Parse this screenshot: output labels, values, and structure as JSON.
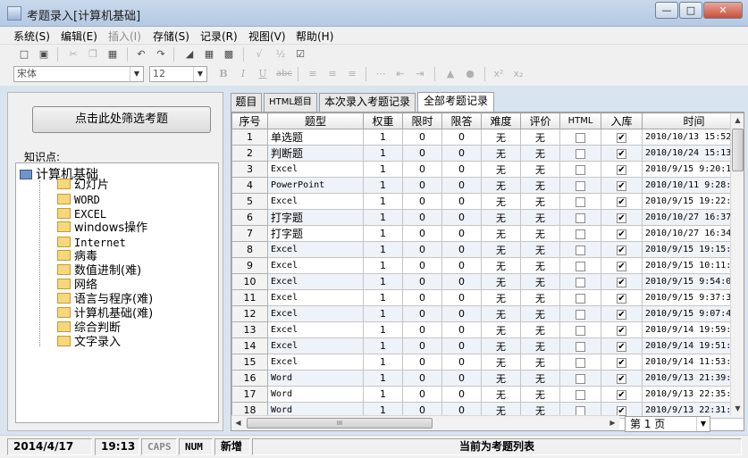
{
  "window": {
    "title": "考题录入[计算机基础]",
    "controls": [
      "minimize",
      "maximize",
      "close"
    ]
  },
  "menu": [
    {
      "label": "系统(S)",
      "enabled": true
    },
    {
      "label": "编辑(E)",
      "enabled": true
    },
    {
      "label": "插入(I)",
      "enabled": false
    },
    {
      "label": "存储(S)",
      "enabled": true
    },
    {
      "label": "记录(R)",
      "enabled": true
    },
    {
      "label": "视图(V)",
      "enabled": true
    },
    {
      "label": "帮助(H)",
      "enabled": true
    }
  ],
  "format_toolbar": {
    "font_name": "宋体",
    "font_size": "12",
    "bold": "B",
    "italic": "I",
    "underline": "U",
    "strike": "abc",
    "superscript": "x²",
    "subscript": "x₂"
  },
  "left_panel": {
    "filter_button": "点击此处筛选考题",
    "knowledge_label": "知识点:",
    "tree_root": "计算机基础",
    "tree_items": [
      "幻灯片",
      "WORD",
      "EXCEL",
      "windows操作",
      "Internet",
      "病毒",
      "数值进制(难)",
      "网络",
      "语言与程序(难)",
      "计算机基础(难)",
      "综合判断",
      "文字录入"
    ]
  },
  "tabs": [
    "题目",
    "HTML题目",
    "本次录入考题记录",
    "全部考题记录"
  ],
  "active_tab": 3,
  "grid": {
    "columns": [
      "序号",
      "题型",
      "权重",
      "限时",
      "限答",
      "难度",
      "评价",
      "HTML",
      "入库",
      "时间"
    ],
    "rows": [
      {
        "seq": "1",
        "type": "单选题",
        "weight": "1",
        "limit_time": "0",
        "limit_answer": "0",
        "difficulty": "无",
        "rating": "无",
        "html": false,
        "stored": true,
        "time": "2010/10/13 15:52"
      },
      {
        "seq": "2",
        "type": "判断题",
        "weight": "1",
        "limit_time": "0",
        "limit_answer": "0",
        "difficulty": "无",
        "rating": "无",
        "html": false,
        "stored": true,
        "time": "2010/10/24 15:13"
      },
      {
        "seq": "3",
        "type": "Excel",
        "weight": "1",
        "limit_time": "0",
        "limit_answer": "0",
        "difficulty": "无",
        "rating": "无",
        "html": false,
        "stored": true,
        "time": "2010/9/15 9:20:1"
      },
      {
        "seq": "4",
        "type": "PowerPoint",
        "weight": "1",
        "limit_time": "0",
        "limit_answer": "0",
        "difficulty": "无",
        "rating": "无",
        "html": false,
        "stored": true,
        "time": "2010/10/11 9:28:"
      },
      {
        "seq": "5",
        "type": "Excel",
        "weight": "1",
        "limit_time": "0",
        "limit_answer": "0",
        "difficulty": "无",
        "rating": "无",
        "html": false,
        "stored": true,
        "time": "2010/9/15 19:22:"
      },
      {
        "seq": "6",
        "type": "打字题",
        "weight": "1",
        "limit_time": "0",
        "limit_answer": "0",
        "difficulty": "无",
        "rating": "无",
        "html": false,
        "stored": true,
        "time": "2010/10/27 16:37"
      },
      {
        "seq": "7",
        "type": "打字题",
        "weight": "1",
        "limit_time": "0",
        "limit_answer": "0",
        "difficulty": "无",
        "rating": "无",
        "html": false,
        "stored": true,
        "time": "2010/10/27 16:34"
      },
      {
        "seq": "8",
        "type": "Excel",
        "weight": "1",
        "limit_time": "0",
        "limit_answer": "0",
        "difficulty": "无",
        "rating": "无",
        "html": false,
        "stored": true,
        "time": "2010/9/15 19:15:"
      },
      {
        "seq": "9",
        "type": "Excel",
        "weight": "1",
        "limit_time": "0",
        "limit_answer": "0",
        "difficulty": "无",
        "rating": "无",
        "html": false,
        "stored": true,
        "time": "2010/9/15 10:11:"
      },
      {
        "seq": "10",
        "type": "Excel",
        "weight": "1",
        "limit_time": "0",
        "limit_answer": "0",
        "difficulty": "无",
        "rating": "无",
        "html": false,
        "stored": true,
        "time": "2010/9/15 9:54:0"
      },
      {
        "seq": "11",
        "type": "Excel",
        "weight": "1",
        "limit_time": "0",
        "limit_answer": "0",
        "difficulty": "无",
        "rating": "无",
        "html": false,
        "stored": true,
        "time": "2010/9/15 9:37:3"
      },
      {
        "seq": "12",
        "type": "Excel",
        "weight": "1",
        "limit_time": "0",
        "limit_answer": "0",
        "difficulty": "无",
        "rating": "无",
        "html": false,
        "stored": true,
        "time": "2010/9/15 9:07:4"
      },
      {
        "seq": "13",
        "type": "Excel",
        "weight": "1",
        "limit_time": "0",
        "limit_answer": "0",
        "difficulty": "无",
        "rating": "无",
        "html": false,
        "stored": true,
        "time": "2010/9/14 19:59:"
      },
      {
        "seq": "14",
        "type": "Excel",
        "weight": "1",
        "limit_time": "0",
        "limit_answer": "0",
        "difficulty": "无",
        "rating": "无",
        "html": false,
        "stored": true,
        "time": "2010/9/14 19:51:"
      },
      {
        "seq": "15",
        "type": "Excel",
        "weight": "1",
        "limit_time": "0",
        "limit_answer": "0",
        "difficulty": "无",
        "rating": "无",
        "html": false,
        "stored": true,
        "time": "2010/9/14 11:53:"
      },
      {
        "seq": "16",
        "type": "Word",
        "weight": "1",
        "limit_time": "0",
        "limit_answer": "0",
        "difficulty": "无",
        "rating": "无",
        "html": false,
        "stored": true,
        "time": "2010/9/13 21:39:"
      },
      {
        "seq": "17",
        "type": "Word",
        "weight": "1",
        "limit_time": "0",
        "limit_answer": "0",
        "difficulty": "无",
        "rating": "无",
        "html": false,
        "stored": true,
        "time": "2010/9/13 22:35:"
      },
      {
        "seq": "18",
        "type": "Word",
        "weight": "1",
        "limit_time": "0",
        "limit_answer": "0",
        "difficulty": "无",
        "rating": "无",
        "html": false,
        "stored": true,
        "time": "2010/9/13 22:31:"
      }
    ]
  },
  "pager": {
    "current": "第 1 页"
  },
  "hscroll_grip": "III",
  "status": {
    "date": "2014/4/17",
    "time": "19:13",
    "caps": "CAPS",
    "num": "NUM",
    "mode": "新增",
    "message": "当前为考题列表"
  }
}
